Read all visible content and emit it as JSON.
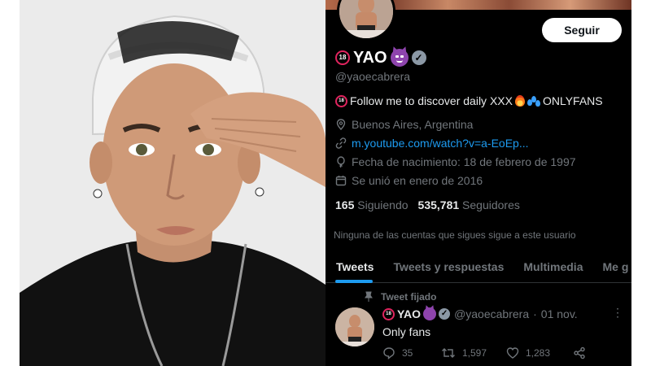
{
  "profile": {
    "follow_button": "Seguir",
    "name": "YAO",
    "handle": "@yaoecabrera",
    "bio_prefix": "Follow me to discover daily XXX",
    "bio_suffix": "ONLYFANS",
    "location": "Buenos Aires, Argentina",
    "link": "m.youtube.com/watch?v=a-EoEp...",
    "birthdate": "Fecha de nacimiento: 18 de febrero de 1997",
    "joined": "Se unió en enero de 2016",
    "following_count": "165",
    "following_label": "Siguiendo",
    "followers_count": "535,781",
    "followers_label": "Seguidores",
    "notice": "Ninguna de las cuentas que sigues sigue a este usuario",
    "badge_text": "18"
  },
  "tabs": [
    {
      "label": "Tweets",
      "active": true
    },
    {
      "label": "Tweets y respuestas",
      "active": false
    },
    {
      "label": "Multimedia",
      "active": false
    },
    {
      "label": "Me g",
      "active": false
    }
  ],
  "tweet": {
    "pinned_label": "Tweet fijado",
    "name": "YAO",
    "handle": "@yaoecabrera",
    "separator": "·",
    "date": "01 nov.",
    "text": "Only fans",
    "replies": "35",
    "retweets": "1,597",
    "likes": "1,283",
    "more": "⋮"
  },
  "colors": {
    "twitter_bg": "#000000",
    "accent_blue": "#1d9bf0",
    "muted_text": "#71767b",
    "badge_red": "#e0245e",
    "devil_purple": "#8e44ad"
  },
  "icons": {
    "location": "location-pin-icon",
    "link": "link-icon",
    "birthday": "balloon-icon",
    "joined": "calendar-icon",
    "pin": "pin-icon",
    "reply": "reply-icon",
    "retweet": "retweet-icon",
    "like": "heart-icon",
    "share": "share-icon",
    "verified": "verified-badge-icon",
    "devil": "smiling-devil-emoji-icon",
    "fire": "fire-emoji-icon",
    "droplets": "sweat-droplets-emoji-icon",
    "adult": "no-one-under-18-icon"
  }
}
